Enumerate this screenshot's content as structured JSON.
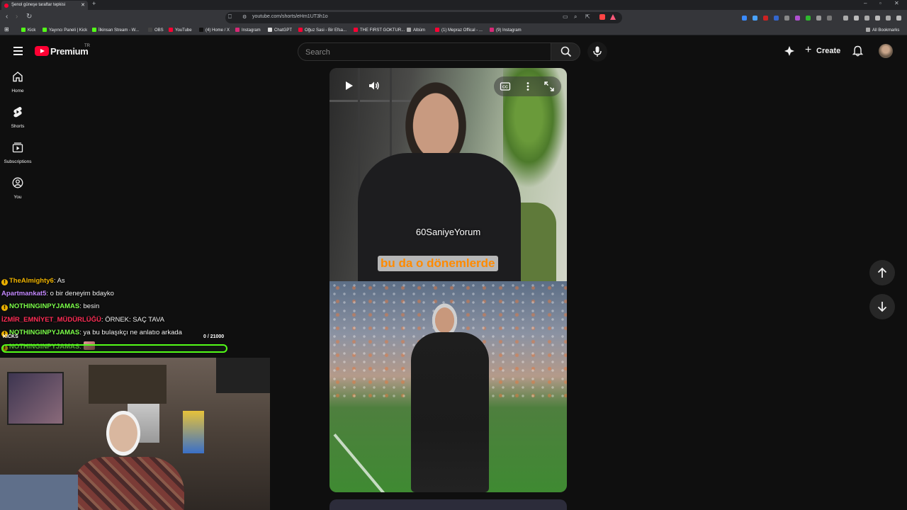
{
  "browser": {
    "tab_title": "Şenol güneşe taraftar tepkisi",
    "url": "youtube.com/shorts/eHm1UT3h1o",
    "bookmarks": [
      {
        "label": "Kick",
        "color": "#53fc18"
      },
      {
        "label": "Yayıncı Paneli | Kick",
        "color": "#53fc18"
      },
      {
        "label": "İlkinsan Stream - W...",
        "color": "#53fc18"
      },
      {
        "label": "OBS",
        "color": "#444444"
      },
      {
        "label": "YouTube",
        "color": "#ff0033"
      },
      {
        "label": "(4) Home / X",
        "color": "#111111"
      },
      {
        "label": "Instagram",
        "color": "#d62976"
      },
      {
        "label": "ChatGPT",
        "color": "#dddddd"
      },
      {
        "label": "Oğuz Sasi - Bir Efsa...",
        "color": "#ff0033"
      },
      {
        "label": "THE FIRST GOKTUR...",
        "color": "#ff0033"
      },
      {
        "label": "Albüm",
        "color": "#aaaaaa"
      },
      {
        "label": "(1) Mepraz Offical - ...",
        "color": "#ff0033"
      },
      {
        "label": "(9) Instagram",
        "color": "#d62976"
      }
    ],
    "all_bookmarks": "All Bookmarks"
  },
  "youtube": {
    "logo_text": "Premium",
    "region": "TR",
    "search_placeholder": "Search",
    "create_label": "Create",
    "sidebar": [
      {
        "label": "Home",
        "icon": "home-icon"
      },
      {
        "label": "Shorts",
        "icon": "shorts-icon"
      },
      {
        "label": "Subscriptions",
        "icon": "subscriptions-icon"
      },
      {
        "label": "You",
        "icon": "you-icon"
      }
    ]
  },
  "video": {
    "watermark": "60SaniyeYorum",
    "subtitle": "bu da o dönemlerde"
  },
  "stream": {
    "chat": [
      {
        "badge": true,
        "user": "TheAlmighty6",
        "color": "#f0b400",
        "message": "As"
      },
      {
        "badge": false,
        "user": "Apartmankat5",
        "color": "#c58aff",
        "message": "o bir deneyim bdayko"
      },
      {
        "badge": true,
        "user": "NOTHINGINPYJAMAS",
        "color": "#7cff4a",
        "message": "besin"
      },
      {
        "badge": false,
        "user": "İZMİR_EMNİYET_MÜDÜRLÜĞÜ",
        "color": "#ff2d55",
        "message": "ÖRNEK: SAÇ TAVA"
      },
      {
        "badge": true,
        "user": "NOTHINGINPYJAMAS",
        "color": "#7cff4a",
        "message": "ya bu bulaşıkçı ne anlatıo arkada"
      },
      {
        "badge": true,
        "user": "NOTHINGINPYJAMAS",
        "color": "#7cff4a",
        "message": ""
      }
    ],
    "goal_label": "KICKS",
    "goal_count": "0 / 21000",
    "goal_progress": 0
  }
}
